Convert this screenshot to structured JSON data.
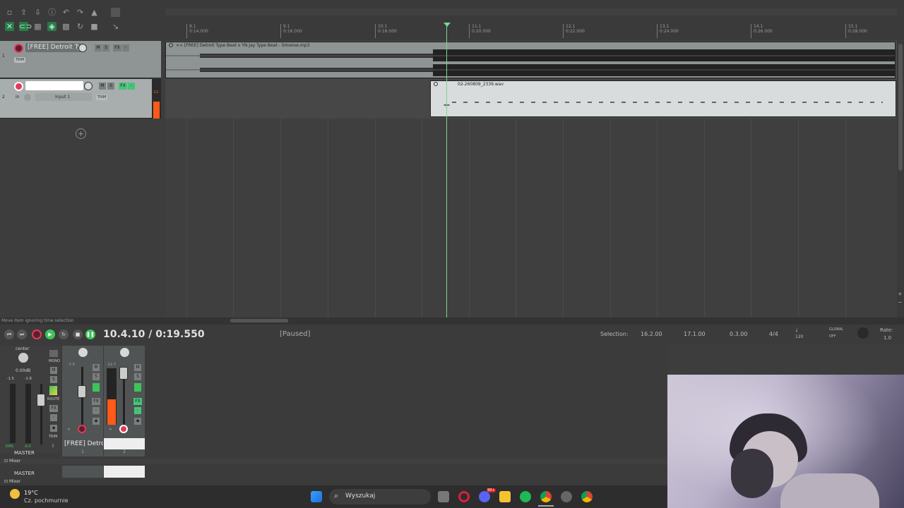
{
  "toolbar": {
    "icons": [
      "new-project-icon",
      "open-project-icon",
      "save-project-icon",
      "project-settings-icon",
      "undo-icon",
      "redo-icon",
      "metronome-icon",
      "grid-toggle-icon",
      "snap-icon",
      "ripple-edit-icon",
      "auto-crossfade-icon",
      "lock-icon",
      "loop-icon",
      "envelope-icon"
    ]
  },
  "ruler": {
    "bars": [
      {
        "bar": "8.1",
        "time": "0:14.000"
      },
      {
        "bar": "9.1",
        "time": "0:16.000"
      },
      {
        "bar": "10.1",
        "time": "0:18.000"
      },
      {
        "bar": "11.1",
        "time": "0:20.000"
      },
      {
        "bar": "12.1",
        "time": "0:22.000"
      },
      {
        "bar": "13.1",
        "time": "0:24.000"
      },
      {
        "bar": "14.1",
        "time": "0:26.000"
      },
      {
        "bar": "15.1",
        "time": "0:28.000"
      }
    ]
  },
  "tracks": [
    {
      "number": "1",
      "name": "[FREE] Detroit Type",
      "m": "M",
      "s": "S",
      "fx": "FX",
      "trim": "TRIM"
    },
    {
      "number": "2",
      "name": "",
      "m": "M",
      "s": "S",
      "fx": "FX",
      "input_label": "in",
      "input": "Input 1",
      "trim": "TRIM",
      "meter_readout": "-12"
    }
  ],
  "items": {
    "item1": {
      "title": "<< [FREE] Detroit Type Beat x YN Jay Type Beat - Smoove.mp3"
    },
    "item2": {
      "title": "02-260809_2339.wav"
    }
  },
  "status_bar": {
    "text": "Move item ignoring time selection"
  },
  "transport": {
    "position": "10.4.10 / 0:19.550",
    "state": "[Paused]",
    "selection_label": "Selection:",
    "selection_start": "16.2.00",
    "selection_end": "17.1.00",
    "selection_length": "0.3.00",
    "time_signature": "4/4",
    "tempo": "120",
    "global_label": "GLOBAL",
    "global_state": "OFF",
    "rate_label": "Rate:",
    "rate": "1.0"
  },
  "mixer": {
    "master": {
      "pan": "center",
      "volume": "0.00dB",
      "peak_l": "-1.5",
      "peak_r": "-1.8",
      "rms_label": "RMS",
      "rms": "-8.0",
      "name": "MASTER",
      "mono": "MONO",
      "m": "M",
      "s": "S",
      "fx": "FX",
      "route": "ROUTE",
      "trim": "TRIM",
      "i": "i"
    },
    "strip1": {
      "name": "[FREE] Detroi",
      "number": "1",
      "m": "M",
      "s": "S",
      "fx": "FX",
      "peak": "-7.5"
    },
    "strip2": {
      "name": "",
      "number": "2",
      "m": "M",
      "s": "S",
      "fx": "FX",
      "peak": "-12.7"
    },
    "dock_tabs": [
      "Mixer",
      "Mixer"
    ],
    "second_row_master": "MASTER"
  },
  "taskbar": {
    "weather_temp": "19°C",
    "weather_desc": "Cz. pochmurnie",
    "search_placeholder": "Wyszukaj",
    "apps": [
      "windows-start-icon",
      "search-icon",
      "task-view-icon",
      "opera-icon",
      "discord-icon",
      "file-explorer-icon",
      "spotify-icon",
      "chrome-icon",
      "settings-icon",
      "chrome-icon"
    ],
    "discord_badge": "99+"
  },
  "colors": {
    "record_red": "#e23a5a",
    "play_green": "#3fc45a",
    "fx_green": "#47c47a",
    "cursor_green": "#7fd68f",
    "meter_orange": "#ff5a1a"
  }
}
